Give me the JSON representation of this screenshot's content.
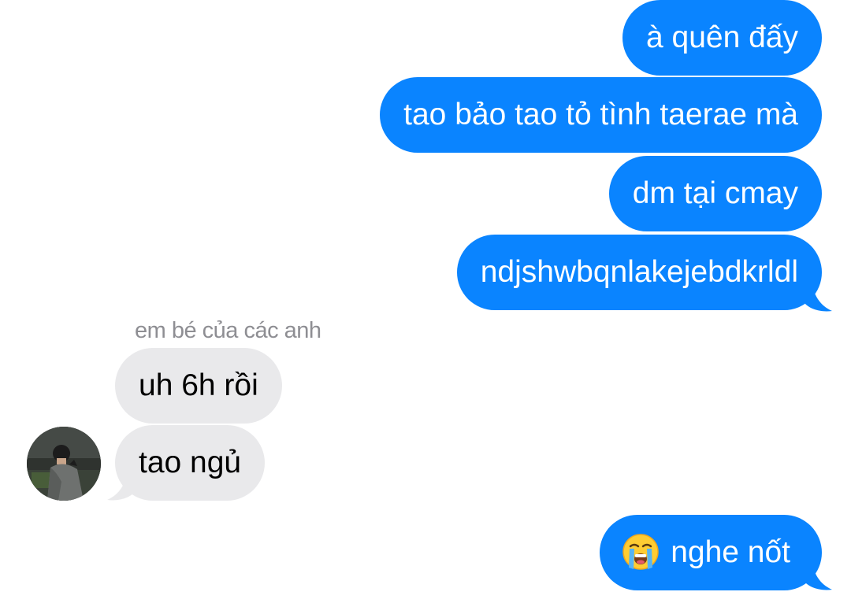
{
  "conversation": {
    "messages": [
      {
        "direction": "outgoing",
        "text": "à quên đấy"
      },
      {
        "direction": "outgoing",
        "text": "tao bảo tao tỏ tình taerae mà"
      },
      {
        "direction": "outgoing",
        "text": "dm tại cmay"
      },
      {
        "direction": "outgoing",
        "text": "ndjshwbqnlakejebdkrldl"
      },
      {
        "direction": "incoming",
        "text": "uh 6h rồi"
      },
      {
        "direction": "incoming",
        "text": "tao ngủ"
      },
      {
        "direction": "outgoing",
        "text": "nghe nốt",
        "emoji": "loudly-crying-face"
      }
    ],
    "sender_name": "em bé của các anh"
  },
  "colors": {
    "outgoing_bubble": "#0a84ff",
    "incoming_bubble": "#e9e9eb",
    "sender_name": "#8e8e93"
  }
}
